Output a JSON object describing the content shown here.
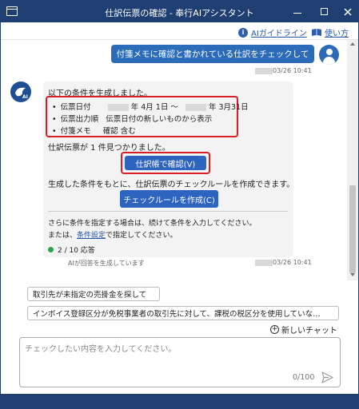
{
  "window": {
    "title": "仕訳伝票の確認 - 奉行AIアシスタント",
    "minimize": "—",
    "maximize": "☐",
    "close": "✕"
  },
  "toolbar": {
    "guide_label": "AIガイドライン",
    "howto_label": "使い方",
    "guide_icon": "info-icon",
    "howto_icon": "book-icon"
  },
  "user_message": {
    "text": "付箋メモに確認と書かれている仕訳をチェックして",
    "time": "03/26 10:41"
  },
  "ai_message": {
    "intro": "以下の条件を生成しました。",
    "conditions": [
      {
        "bullet": "•",
        "label": "伝票日付",
        "value": "年 4月 1日 ～",
        "value2": "年 3月31日"
      },
      {
        "bullet": "•",
        "label": "伝票出力順",
        "value": "伝票日付の新しいものから表示"
      },
      {
        "bullet": "•",
        "label": "付箋メモ",
        "value": "確認 含む"
      }
    ],
    "found": "仕訳伝票が 1 件見つかりました。",
    "confirm_button": "仕訳帳で確認(V)",
    "rule_note": "生成した条件をもとに、仕訳伝票のチェックルールを作成できます。",
    "rule_button": "チェックルールを作成(C)",
    "hint1": "さらに条件を指定する場合は、続けて条件を入力してください。",
    "hint2_pre": "または、",
    "hint2_link": "条件設定",
    "hint2_post": "で指定してください。",
    "answer_count": "2 / 10 応答",
    "notice": "AIが回答を生成しています",
    "time": "03/26 10:41"
  },
  "suggestions": [
    "取引先が未指定の売掛金を探して",
    "インボイス登録区分が免税事業者の取引先に対して、課税の税区分を使用していな…"
  ],
  "new_chat_label": "新しいチャット",
  "input": {
    "placeholder": "チェックしたい内容を入力してください。",
    "value": "",
    "char_count": "0/100"
  },
  "colors": {
    "titlebar": "#1f3f73",
    "accent": "#2c6bb8",
    "button": "#2d64c0",
    "highlight": "#d81f26",
    "status_dot": "#2aa44a"
  }
}
